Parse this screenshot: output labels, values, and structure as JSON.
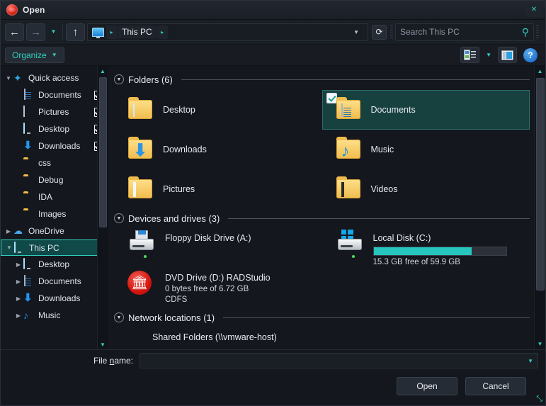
{
  "window": {
    "title": "Open",
    "app_icon": "radstudio-icon",
    "close_label": "✕"
  },
  "nav": {
    "back_icon": "←",
    "forward_icon": "→",
    "recent_chevron": "▼",
    "up_icon": "↑",
    "breadcrumb_root_icon": "this-pc-monitor-icon",
    "breadcrumb_sep": "▸",
    "breadcrumb_label": "This PC",
    "breadcrumb_end_chevron": "▸",
    "address_dropdown": "▼",
    "refresh_icon": "⟳"
  },
  "search": {
    "placeholder": "Search This PC",
    "icon": "search-icon"
  },
  "toolbar": {
    "organize_label": "Organize",
    "organize_caret": "▼",
    "view_caret": "▼",
    "help_label": "?"
  },
  "sidebar": {
    "items": [
      {
        "label": "Quick access",
        "icon": "star-icon",
        "indent": 0,
        "twisty": "▼",
        "pinned": false,
        "selected": false
      },
      {
        "label": "Documents",
        "icon": "document-icon",
        "indent": 1,
        "twisty": "",
        "pinned": true,
        "selected": false
      },
      {
        "label": "Pictures",
        "icon": "picture-icon",
        "indent": 1,
        "twisty": "",
        "pinned": true,
        "selected": false
      },
      {
        "label": "Desktop",
        "icon": "monitor-icon",
        "indent": 1,
        "twisty": "",
        "pinned": true,
        "selected": false
      },
      {
        "label": "Downloads",
        "icon": "download-icon",
        "indent": 1,
        "twisty": "",
        "pinned": true,
        "selected": false
      },
      {
        "label": "css",
        "icon": "folder-icon",
        "indent": 1,
        "twisty": "",
        "pinned": false,
        "selected": false
      },
      {
        "label": "Debug",
        "icon": "folder-icon",
        "indent": 1,
        "twisty": "",
        "pinned": false,
        "selected": false
      },
      {
        "label": "IDA",
        "icon": "folder-icon",
        "indent": 1,
        "twisty": "",
        "pinned": false,
        "selected": false
      },
      {
        "label": "Images",
        "icon": "folder-icon",
        "indent": 1,
        "twisty": "",
        "pinned": false,
        "selected": false
      },
      {
        "label": "OneDrive",
        "icon": "cloud-icon",
        "indent": 0,
        "twisty": "▶",
        "pinned": false,
        "selected": false
      },
      {
        "label": "This PC",
        "icon": "monitor-icon",
        "indent": 0,
        "twisty": "▼",
        "pinned": false,
        "selected": true
      },
      {
        "label": "Desktop",
        "icon": "monitor-icon",
        "indent": 1,
        "twisty": "▶",
        "pinned": false,
        "selected": false
      },
      {
        "label": "Documents",
        "icon": "document-icon",
        "indent": 1,
        "twisty": "▶",
        "pinned": false,
        "selected": false
      },
      {
        "label": "Downloads",
        "icon": "download-icon",
        "indent": 1,
        "twisty": "▶",
        "pinned": false,
        "selected": false
      },
      {
        "label": "Music",
        "icon": "music-icon",
        "indent": 1,
        "twisty": "▶",
        "pinned": false,
        "selected": false
      }
    ]
  },
  "content": {
    "groups": [
      {
        "title": "Folders (6)",
        "toggle": "▼"
      },
      {
        "title": "Devices and drives (3)",
        "toggle": "▼"
      },
      {
        "title": "Network locations (1)",
        "toggle": "▼"
      }
    ],
    "folders": [
      {
        "label": "Desktop",
        "icon": "folder-desktop-icon",
        "selected": false,
        "checked": false
      },
      {
        "label": "Documents",
        "icon": "folder-documents-icon",
        "selected": true,
        "checked": true
      },
      {
        "label": "Downloads",
        "icon": "folder-downloads-icon",
        "selected": false,
        "checked": false
      },
      {
        "label": "Music",
        "icon": "folder-music-icon",
        "selected": false,
        "checked": false
      },
      {
        "label": "Pictures",
        "icon": "folder-pictures-icon",
        "selected": false,
        "checked": false
      },
      {
        "label": "Videos",
        "icon": "folder-videos-icon",
        "selected": false,
        "checked": false
      }
    ],
    "drives": [
      {
        "name": "Floppy Disk Drive (A:)",
        "icon": "floppy-drive-icon",
        "lines": [],
        "has_bar": false
      },
      {
        "name": "Local Disk (C:)",
        "icon": "local-disk-icon",
        "lines": [
          "15.3 GB free of 59.9 GB"
        ],
        "has_bar": true,
        "bar_percent": 74,
        "bar_color": "#26c6be"
      },
      {
        "name": "DVD Drive (D:) RADStudio",
        "icon": "dvd-drive-icon",
        "lines": [
          "0 bytes free of 6.72 GB",
          "CDFS"
        ],
        "has_bar": false
      }
    ],
    "network": [
      {
        "name": "Shared Folders (\\\\vmware-host)",
        "icon": "network-share-icon"
      }
    ]
  },
  "footer": {
    "filename_label_pre": "File ",
    "filename_label_key": "n",
    "filename_label_post": "ame:",
    "filename_value": "",
    "filename_caret": "▼",
    "open_label": "Open",
    "cancel_label": "Cancel",
    "resize_grip": "⤡"
  },
  "colors": {
    "accent": "#2fd0bd",
    "selection_bg": "#17413f",
    "window_bg": "#14171d",
    "folder_yellow": "#f0bc4d"
  }
}
